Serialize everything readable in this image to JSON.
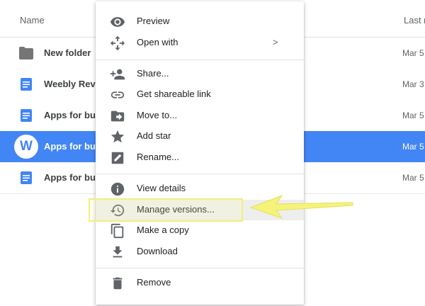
{
  "header": {
    "name_label": "Name",
    "modified_label": "Last m"
  },
  "files": [
    {
      "name": "New folder",
      "modified": "Mar 5",
      "type": "folder"
    },
    {
      "name": "Weebly Revie",
      "modified": "Mar 3",
      "type": "doc"
    },
    {
      "name": "Apps for busi",
      "modified": "Mar 5",
      "type": "doc"
    },
    {
      "name": "Apps for busi",
      "modified": "Mar 5",
      "type": "weebly",
      "icon_letter": "W"
    },
    {
      "name": "Apps for busi",
      "modified": "Mar 5",
      "type": "doc"
    }
  ],
  "menu": {
    "items": [
      {
        "label": "Preview",
        "icon": "eye-icon"
      },
      {
        "label": "Open with",
        "icon": "move-arrows-icon",
        "submenu": ">"
      },
      {
        "label": "Share...",
        "icon": "person-add-icon"
      },
      {
        "label": "Get shareable link",
        "icon": "link-icon"
      },
      {
        "label": "Move to...",
        "icon": "folder-move-icon"
      },
      {
        "label": "Add star",
        "icon": "star-icon"
      },
      {
        "label": "Rename...",
        "icon": "edit-icon"
      },
      {
        "label": "View details",
        "icon": "info-icon"
      },
      {
        "label": "Manage versions...",
        "icon": "history-icon"
      },
      {
        "label": "Make a copy",
        "icon": "copy-icon"
      },
      {
        "label": "Download",
        "icon": "download-icon"
      },
      {
        "label": "Remove",
        "icon": "trash-icon"
      }
    ]
  },
  "colors": {
    "selected_row": "#4285f4",
    "doc_icon": "#4285f4",
    "highlight": "#f2ef7a",
    "menu_icon": "#5f6368"
  }
}
